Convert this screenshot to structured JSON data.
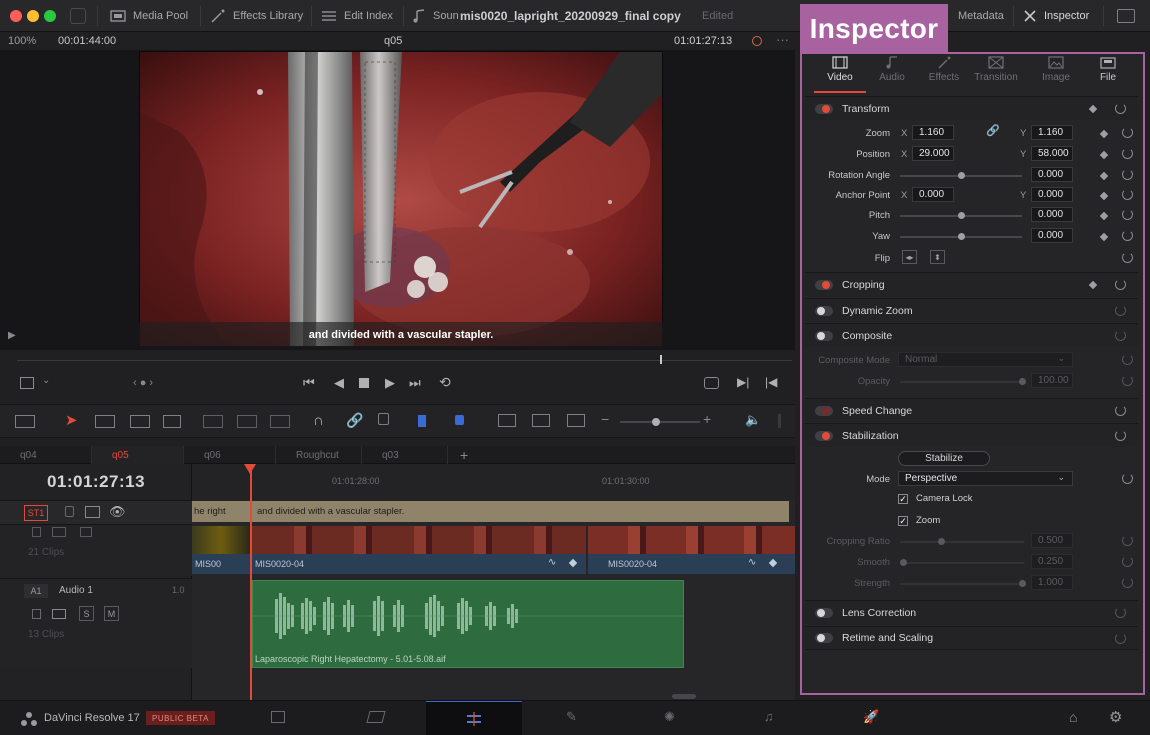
{
  "topbar": {
    "media_pool": "Media Pool",
    "effects_library": "Effects Library",
    "edit_index": "Edit Index",
    "sound_library": "Soun",
    "project_title": "mis0020_lapright_20200929_final copy",
    "edited_status": "Edited",
    "metadata": "Metadata",
    "inspector": "Inspector"
  },
  "viewer": {
    "zoom": "100%",
    "source_timecode": "00:01:44:00",
    "timeline_name": "q05",
    "record_timecode": "01:01:27:13",
    "subtitle_text": "and divided with a vascular stapler."
  },
  "timeline": {
    "tabs": [
      {
        "label": "q04"
      },
      {
        "label": "q05"
      },
      {
        "label": "q06"
      },
      {
        "label": "Roughcut"
      },
      {
        "label": "q03"
      }
    ],
    "timecode": "01:01:27:13",
    "ruler": [
      "01:01:28:00",
      "01:01:30:00"
    ],
    "subtitle_track": {
      "id": "ST1",
      "clip1": "he right",
      "clip2": "and divided with a vascular stapler."
    },
    "video_track": {
      "clips_count": "21 Clips",
      "clip_a": "MIS00",
      "clip_b": "MIS0020-04",
      "clip_c": "MIS0020-04"
    },
    "audio_track": {
      "id": "A1",
      "name": "Audio 1",
      "level": "1.0",
      "clips_count": "13 Clips",
      "solo": "S",
      "mute": "M",
      "clip_name": "Laparoscopic Right Hepatectomy - 5.01-5.08.aif"
    }
  },
  "inspector": {
    "title": "Inspector",
    "tabs": [
      {
        "label": "Video",
        "icon": "film-icon"
      },
      {
        "label": "Audio",
        "icon": "music-note-icon"
      },
      {
        "label": "Effects",
        "icon": "magic-wand-icon"
      },
      {
        "label": "Transition",
        "icon": "transition-icon"
      },
      {
        "label": "Image",
        "icon": "image-icon"
      },
      {
        "label": "File",
        "icon": "file-icon"
      }
    ],
    "transform": {
      "title": "Transform",
      "zoom_label": "Zoom",
      "zoom_x": "1.160",
      "zoom_y": "1.160",
      "position_label": "Position",
      "position_x": "29.000",
      "position_y": "58.000",
      "rotation_label": "Rotation Angle",
      "rotation": "0.000",
      "anchor_label": "Anchor Point",
      "anchor_x": "0.000",
      "anchor_y": "0.000",
      "pitch_label": "Pitch",
      "pitch": "0.000",
      "yaw_label": "Yaw",
      "yaw": "0.000",
      "flip_label": "Flip",
      "x_label": "X",
      "y_label": "Y"
    },
    "cropping": {
      "title": "Cropping"
    },
    "dynamic_zoom": {
      "title": "Dynamic Zoom"
    },
    "composite": {
      "title": "Composite",
      "mode_label": "Composite Mode",
      "mode_value": "Normal",
      "opacity_label": "Opacity",
      "opacity_value": "100.00"
    },
    "speed_change": {
      "title": "Speed Change"
    },
    "stabilization": {
      "title": "Stabilization",
      "stabilize_button": "Stabilize",
      "mode_label": "Mode",
      "mode_value": "Perspective",
      "camera_lock": "Camera Lock",
      "zoom": "Zoom",
      "cropping_ratio_label": "Cropping Ratio",
      "cropping_ratio": "0.500",
      "smooth_label": "Smooth",
      "smooth": "0.250",
      "strength_label": "Strength",
      "strength": "1.000"
    },
    "lens_correction": {
      "title": "Lens Correction"
    },
    "retime_scaling": {
      "title": "Retime and Scaling"
    }
  },
  "bottombar": {
    "app_name": "DaVinci Resolve 17",
    "badge": "PUBLIC BETA"
  },
  "colors": {
    "accent_red": "#e24a3a",
    "inspector_highlight": "#a8629f",
    "audio_clip": "#2e6b3f",
    "subtitle_clip": "#8a7f5f"
  }
}
